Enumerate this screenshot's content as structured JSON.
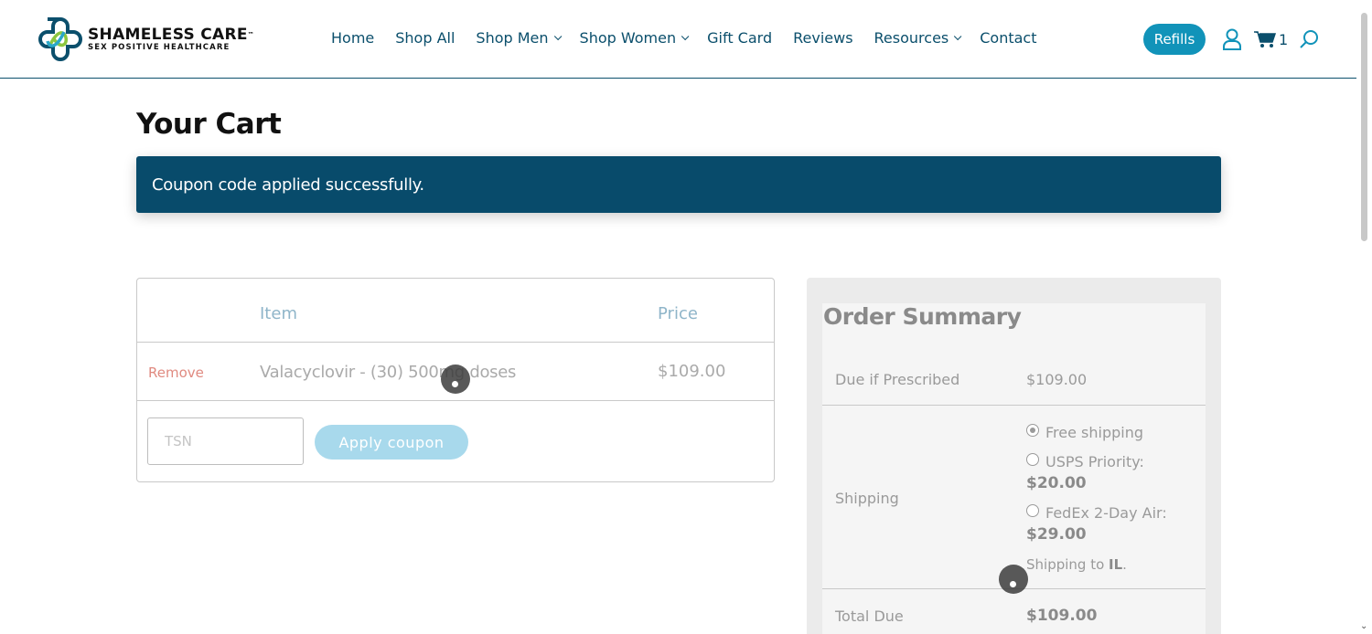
{
  "header": {
    "logo_title": "SHAMELESS CARE",
    "logo_tm": "™",
    "logo_subtitle": "SEX POSITIVE HEALTHCARE",
    "nav": [
      {
        "label": "Home",
        "dropdown": false
      },
      {
        "label": "Shop All",
        "dropdown": false
      },
      {
        "label": "Shop Men",
        "dropdown": true
      },
      {
        "label": "Shop Women",
        "dropdown": true
      },
      {
        "label": "Gift Card",
        "dropdown": false
      },
      {
        "label": "Reviews",
        "dropdown": false
      },
      {
        "label": "Resources",
        "dropdown": true
      },
      {
        "label": "Contact",
        "dropdown": false
      }
    ],
    "refills_label": "Refills",
    "cart_count": "1",
    "icons": [
      "user-icon",
      "cart-icon",
      "search-icon"
    ]
  },
  "page": {
    "title": "Your Cart",
    "notice": "Coupon code applied successfully."
  },
  "cart": {
    "columns": {
      "item": "Item",
      "price": "Price"
    },
    "rows": [
      {
        "remove_label": "Remove",
        "item": "Valacyclovir - (30) 500mg doses",
        "price": "$109.00"
      }
    ],
    "coupon": {
      "placeholder": "TSN",
      "value": "",
      "apply_label": "Apply coupon"
    }
  },
  "summary": {
    "title": "Order Summary",
    "due_label": "Due if Prescribed",
    "due_value": "$109.00",
    "shipping_label": "Shipping",
    "shipping_options": [
      {
        "label": "Free shipping",
        "price": "",
        "checked": true
      },
      {
        "label": "USPS Priority:",
        "price": "$20.00",
        "checked": false
      },
      {
        "label": "FedEx 2-Day Air:",
        "price": "$29.00",
        "checked": false
      }
    ],
    "ship_to_prefix": "Shipping to ",
    "ship_to_state": "IL",
    "ship_to_suffix": ".",
    "total_label": "Total Due",
    "total_value": "$109.00"
  },
  "colors": {
    "brand": "#0b4f6c",
    "accent": "#1193b9",
    "notice_bg": "#084b6b",
    "remove": "#e08a80",
    "apply_button": "#a8d9ec"
  }
}
